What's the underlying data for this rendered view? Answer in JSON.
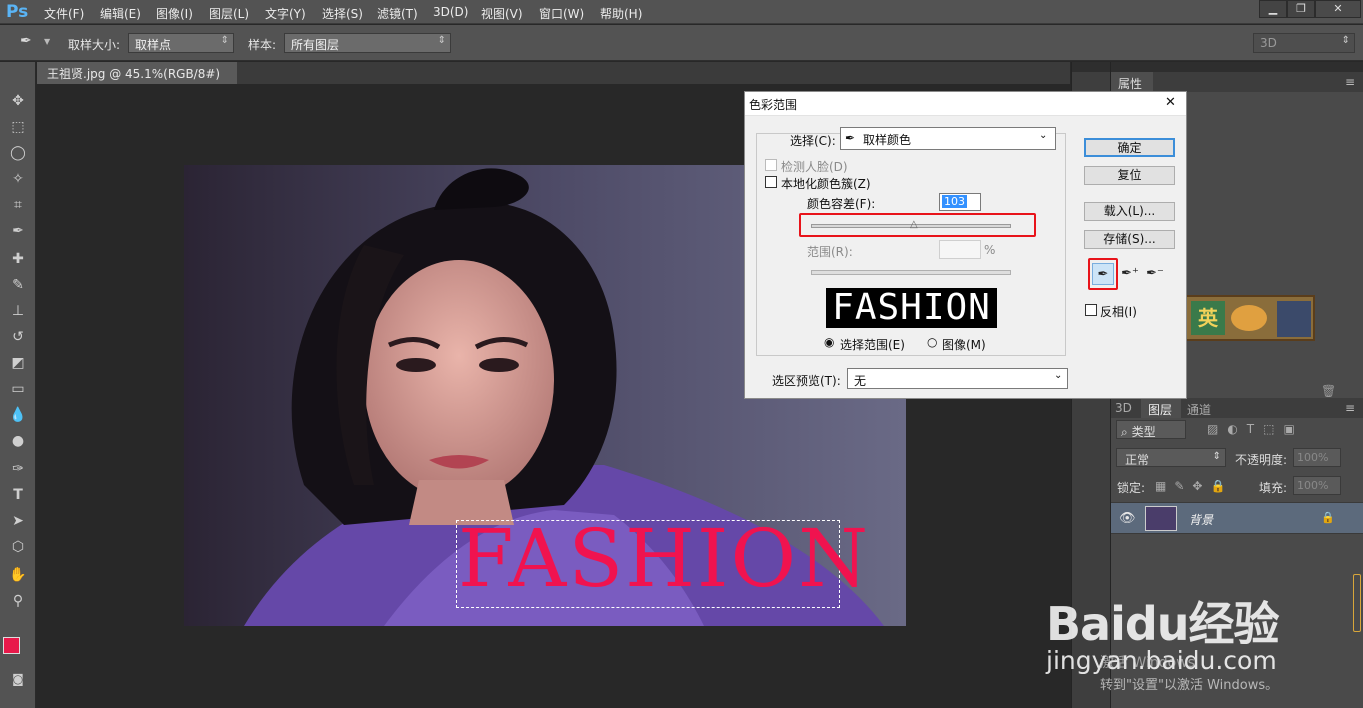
{
  "app": {
    "logo": "Ps"
  },
  "menu": [
    "文件(F)",
    "编辑(E)",
    "图像(I)",
    "图层(L)",
    "文字(Y)",
    "选择(S)",
    "滤镜(T)",
    "3D(D)",
    "视图(V)",
    "窗口(W)",
    "帮助(H)"
  ],
  "window_controls": {
    "minimize": "▁",
    "restore": "❐",
    "close": "✕"
  },
  "options": {
    "sample_size_label": "取样大小:",
    "sample_size_value": "取样点",
    "sample_label": "样本:",
    "sample_value": "所有图层",
    "workspace": "3D"
  },
  "document": {
    "tab_title": "王祖贤.jpg @ 45.1%(RGB/8#) *",
    "overlay_text": "FASHION"
  },
  "dialog": {
    "title": "色彩范围",
    "close": "✕",
    "select_label": "选择(C):",
    "select_value": "取样颜色",
    "detect_faces": "检测人脸(D)",
    "localized_clusters": "本地化颜色簇(Z)",
    "fuzziness_label": "颜色容差(F):",
    "fuzziness_value": "103",
    "range_label": "范围(R):",
    "range_unit": "%",
    "preview_text": "FASHION",
    "radio_selection": "选择范围(E)",
    "radio_image": "图像(M)",
    "selection_preview_label": "选区预览(T):",
    "selection_preview_value": "无",
    "ok": "确定",
    "reset": "复位",
    "load": "载入(L)...",
    "save": "存储(S)...",
    "invert": "反相(I)"
  },
  "properties": {
    "tab": "属性"
  },
  "layers": {
    "tabs": [
      "3D",
      "图层",
      "通道"
    ],
    "kind_label": "类型",
    "blend_mode": "正常",
    "opacity_label": "不透明度:",
    "opacity_value": "100%",
    "lock_label": "锁定:",
    "fill_label": "填充:",
    "fill_value": "100%",
    "layer_name": "背景"
  },
  "watermark": {
    "brand": "Baidu经验",
    "url": "jingyan.baidu.com",
    "activate": "激活 Windows",
    "activate_hint": "转到\"设置\"以激活 Windows。"
  },
  "colors": {
    "foreground": "#e8194a",
    "background": "#111111",
    "highlight": "#e8131a",
    "text_overlay": "#f0134f"
  }
}
